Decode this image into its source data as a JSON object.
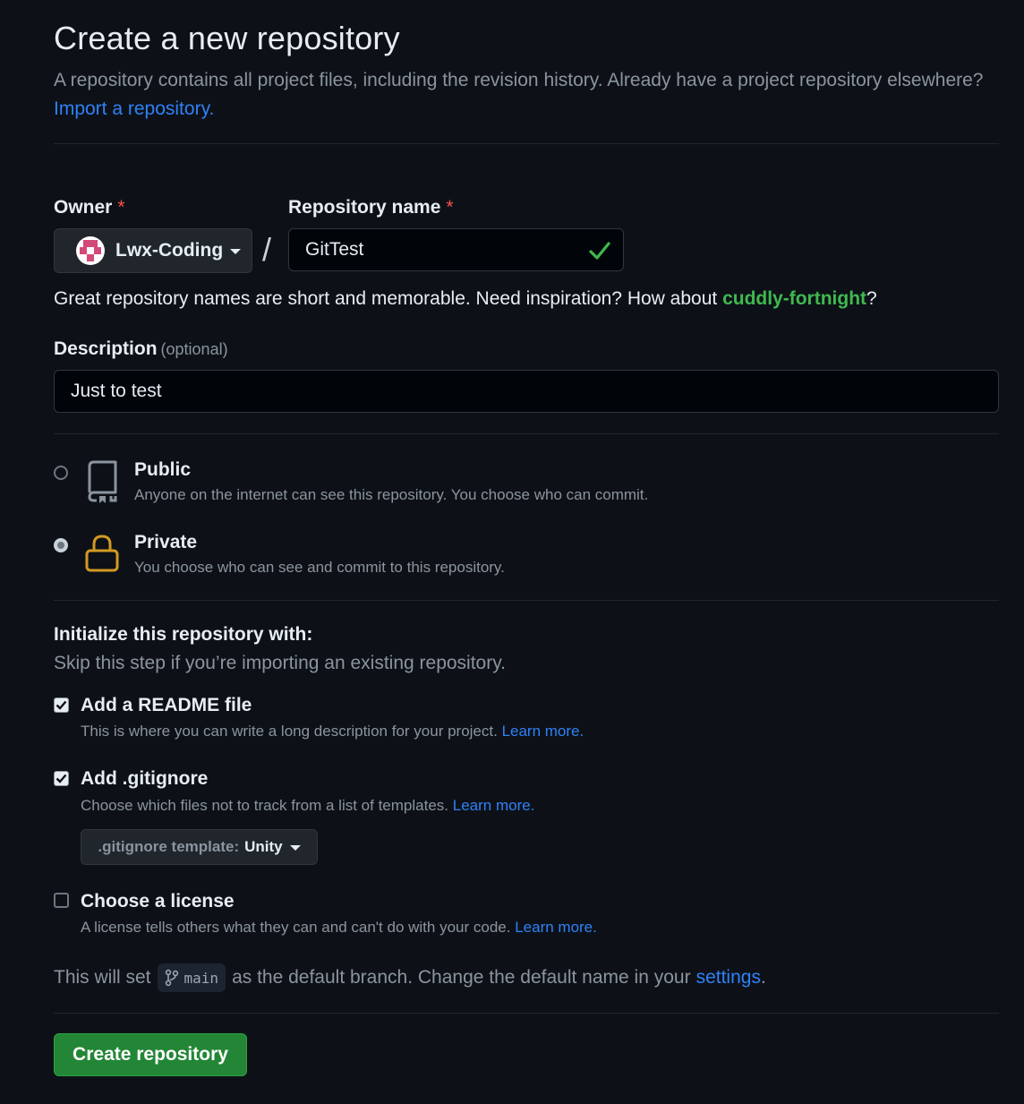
{
  "header": {
    "title": "Create a new repository",
    "subtitle": "A repository contains all project files, including the revision history. Already have a project repository elsewhere?",
    "import_link": "Import a repository."
  },
  "owner": {
    "label": "Owner",
    "required_mark": "*",
    "name": "Lwx-Coding"
  },
  "repo_name": {
    "label": "Repository name",
    "required_mark": "*",
    "value": "GitTest"
  },
  "name_hint": {
    "text": "Great repository names are short and memorable. Need inspiration? How about",
    "suggestion": "cuddly-fortnight",
    "suffix": "?"
  },
  "description": {
    "label": "Description",
    "optional": "(optional)",
    "value": "Just to test"
  },
  "visibility": {
    "selected": "private",
    "public": {
      "title": "Public",
      "desc": "Anyone on the internet can see this repository. You choose who can commit."
    },
    "private": {
      "title": "Private",
      "desc": "You choose who can see and commit to this repository."
    }
  },
  "init": {
    "title": "Initialize this repository with:",
    "subtitle": "Skip this step if you’re importing an existing repository.",
    "readme": {
      "title": "Add a README file",
      "desc": "This is where you can write a long description for your project.",
      "link": "Learn more.",
      "checked": true
    },
    "gitignore": {
      "title": "Add .gitignore",
      "desc": "Choose which files not to track from a list of templates.",
      "link": "Learn more.",
      "checked": true,
      "template_prefix": ".gitignore template:",
      "template_value": "Unity"
    },
    "license": {
      "title": "Choose a license",
      "desc": "A license tells others what they can and can't do with your code.",
      "link": "Learn more.",
      "checked": false
    }
  },
  "branch_note": {
    "before": "This will set",
    "branch": "main",
    "after": "as the default branch. Change the default name in your",
    "link": "settings",
    "end": "."
  },
  "submit": {
    "label": "Create repository"
  },
  "colors": {
    "accent_link": "#2f81f7",
    "success_green": "#3fb950",
    "button_green": "#238636",
    "required_red": "#f85149",
    "lock_amber": "#d29922"
  }
}
